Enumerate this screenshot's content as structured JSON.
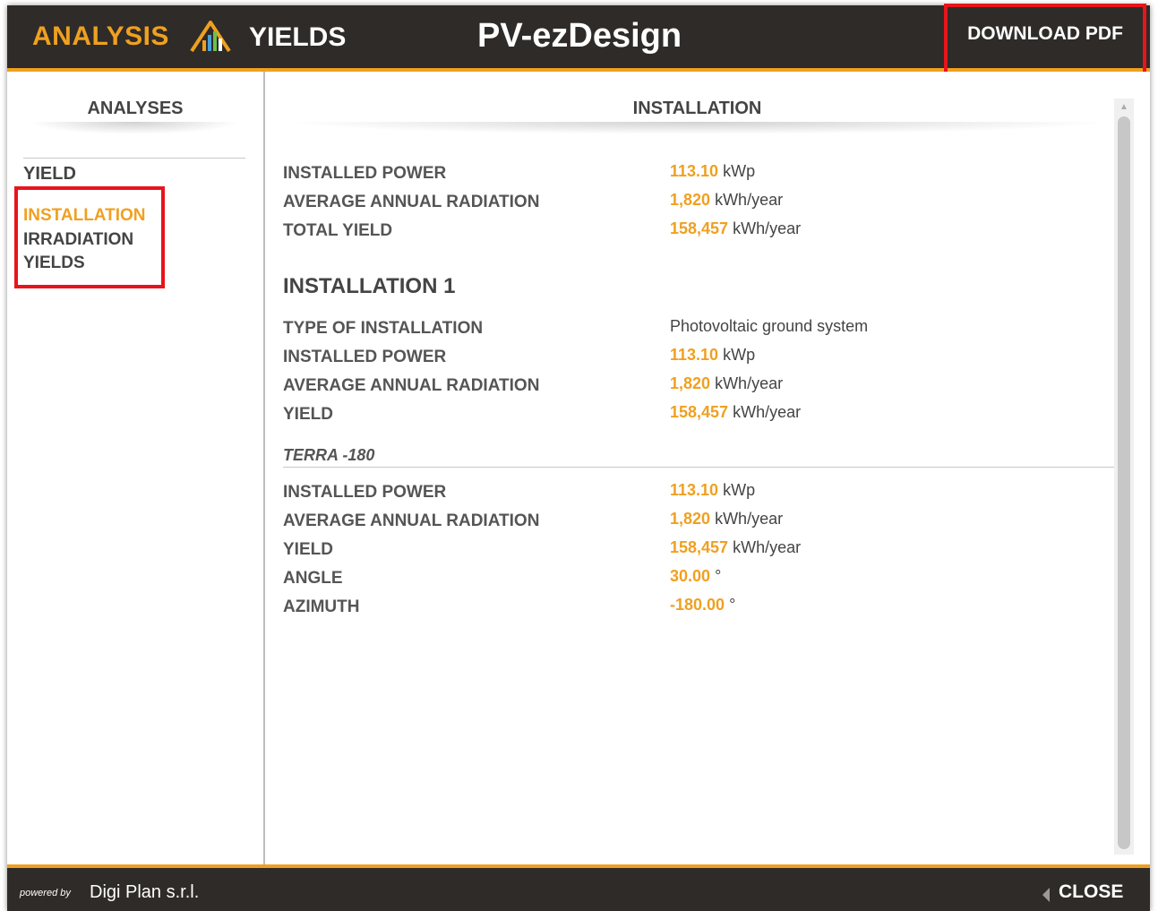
{
  "header": {
    "analysis_label": "ANALYSIS",
    "icon": "chart-growth-icon",
    "yields_label": "YIELDS",
    "brand": "PV-ezDesign",
    "download_label": "DOWNLOAD PDF"
  },
  "sidebar": {
    "title": "ANALYSES",
    "group": "YIELD",
    "items": [
      {
        "label": "INSTALLATION",
        "active": true
      },
      {
        "label": "IRRADIATION",
        "active": false
      },
      {
        "label": "YIELDS",
        "active": false
      }
    ]
  },
  "main": {
    "title": "INSTALLATION",
    "summary": [
      {
        "label": "INSTALLED POWER",
        "value": "113.10",
        "unit": "kWp"
      },
      {
        "label": "AVERAGE ANNUAL RADIATION",
        "value": "1,820",
        "unit": "kWh/year"
      },
      {
        "label": "TOTAL YIELD",
        "value": "158,457",
        "unit": "kWh/year"
      }
    ],
    "installation1": {
      "title": "INSTALLATION 1",
      "type_label": "TYPE OF INSTALLATION",
      "type_value": "Photovoltaic ground system",
      "rows": [
        {
          "label": "INSTALLED POWER",
          "value": "113.10",
          "unit": "kWp"
        },
        {
          "label": "AVERAGE ANNUAL RADIATION",
          "value": "1,820",
          "unit": "kWh/year"
        },
        {
          "label": "YIELD",
          "value": "158,457",
          "unit": "kWh/year"
        }
      ]
    },
    "terra": {
      "title": "TERRA -180",
      "rows": [
        {
          "label": "INSTALLED POWER",
          "value": "113.10",
          "unit": "kWp"
        },
        {
          "label": "AVERAGE ANNUAL RADIATION",
          "value": "1,820",
          "unit": "kWh/year"
        },
        {
          "label": "YIELD",
          "value": "158,457",
          "unit": "kWh/year"
        },
        {
          "label": "ANGLE",
          "value": "30.00",
          "unit": "°"
        },
        {
          "label": "AZIMUTH",
          "value": "-180.00",
          "unit": "°"
        }
      ]
    }
  },
  "footer": {
    "powered_by": "powered by",
    "company": "Digi Plan s.r.l.",
    "close_label": "CLOSE",
    "close_icon": "chevron-left-icon"
  },
  "colors": {
    "accent": "#f0a020",
    "header_bg": "#2e2b28",
    "highlight_border": "#e8141c"
  }
}
